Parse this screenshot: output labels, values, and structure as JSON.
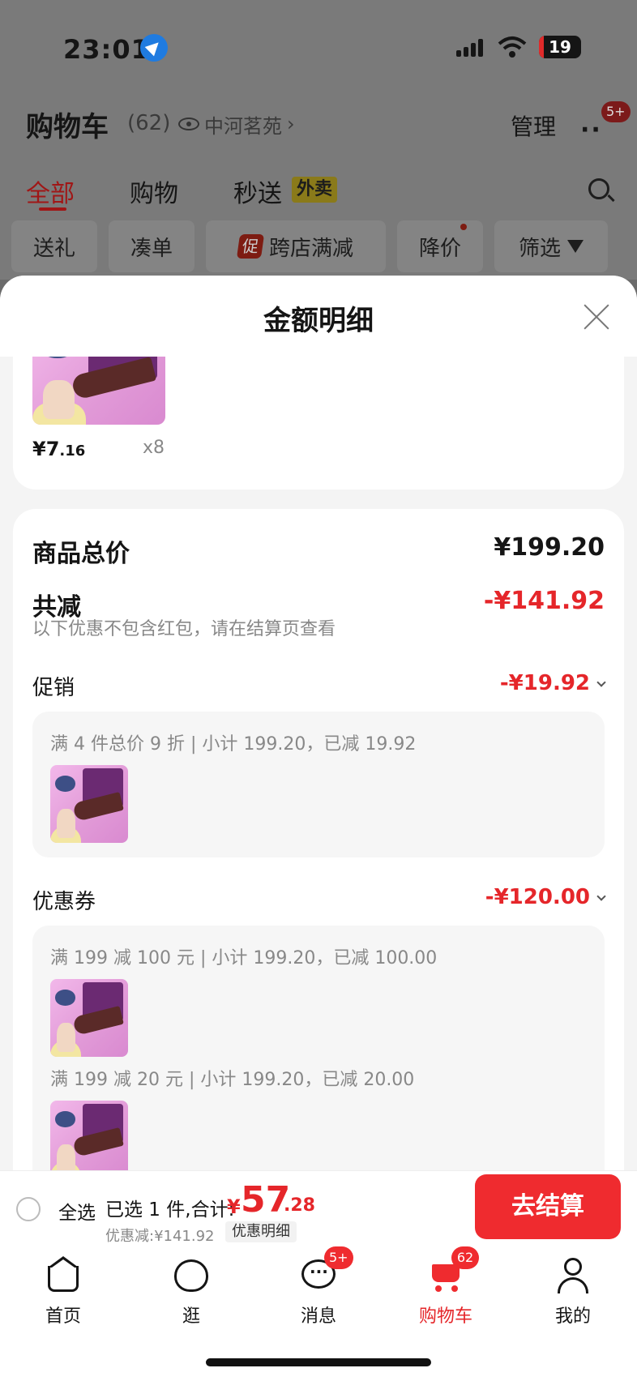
{
  "status_bar": {
    "time": "23:01",
    "battery": "19"
  },
  "header": {
    "title": "购物车",
    "count": "(62)",
    "address": "中河茗苑",
    "address_chevron": "›",
    "manage": "管理",
    "more_badge": "5+"
  },
  "tabs": [
    {
      "label": "全部",
      "active": true
    },
    {
      "label": "购物"
    },
    {
      "label": "秒送"
    }
  ],
  "takeout_tag": "外卖",
  "chips": {
    "gift": "送礼",
    "bundle": "凑单",
    "promo_tag": "促",
    "cross_store": "跨店满减",
    "price_drop": "降价",
    "filter": "筛选"
  },
  "sheet": {
    "title": "金额明细",
    "product": {
      "price_symbol": "¥",
      "price_int": "7",
      "price_dec": ".16",
      "qty": "x8"
    },
    "summary": {
      "total_label": "商品总价",
      "total_value": "¥199.20",
      "discount_label": "共减",
      "discount_value": "-¥141.92",
      "hint": "以下优惠不包含红包，请在结算页查看"
    },
    "promotion": {
      "label": "促销",
      "value": "-¥19.92",
      "line": "满 4 件总价 9 折 | 小计 199.20，已减 19.92"
    },
    "coupon": {
      "label": "优惠券",
      "value": "-¥120.00",
      "line1": "满 199 减 100 元 | 小计 199.20，已减 100.00",
      "line2": "满 199 减 20 元 | 小计 199.20，已减 20.00"
    }
  },
  "checkout": {
    "select_all": "全选",
    "selected": "已选 1 件,合计:",
    "total_symbol": "¥",
    "total_int": "57",
    "total_dec": ".28",
    "discount": "优惠减:¥141.92",
    "detail_button": "优惠明细",
    "pay_button": "去结算"
  },
  "tabbar": [
    {
      "label": "首页"
    },
    {
      "label": "逛"
    },
    {
      "label": "消息",
      "badge": "5+"
    },
    {
      "label": "购物车",
      "badge": "62",
      "active": true
    },
    {
      "label": "我的"
    }
  ],
  "colors": {
    "accent": "#ef2b2f",
    "price_red": "#e5262a",
    "dim_bg": "#7a7a7a"
  }
}
